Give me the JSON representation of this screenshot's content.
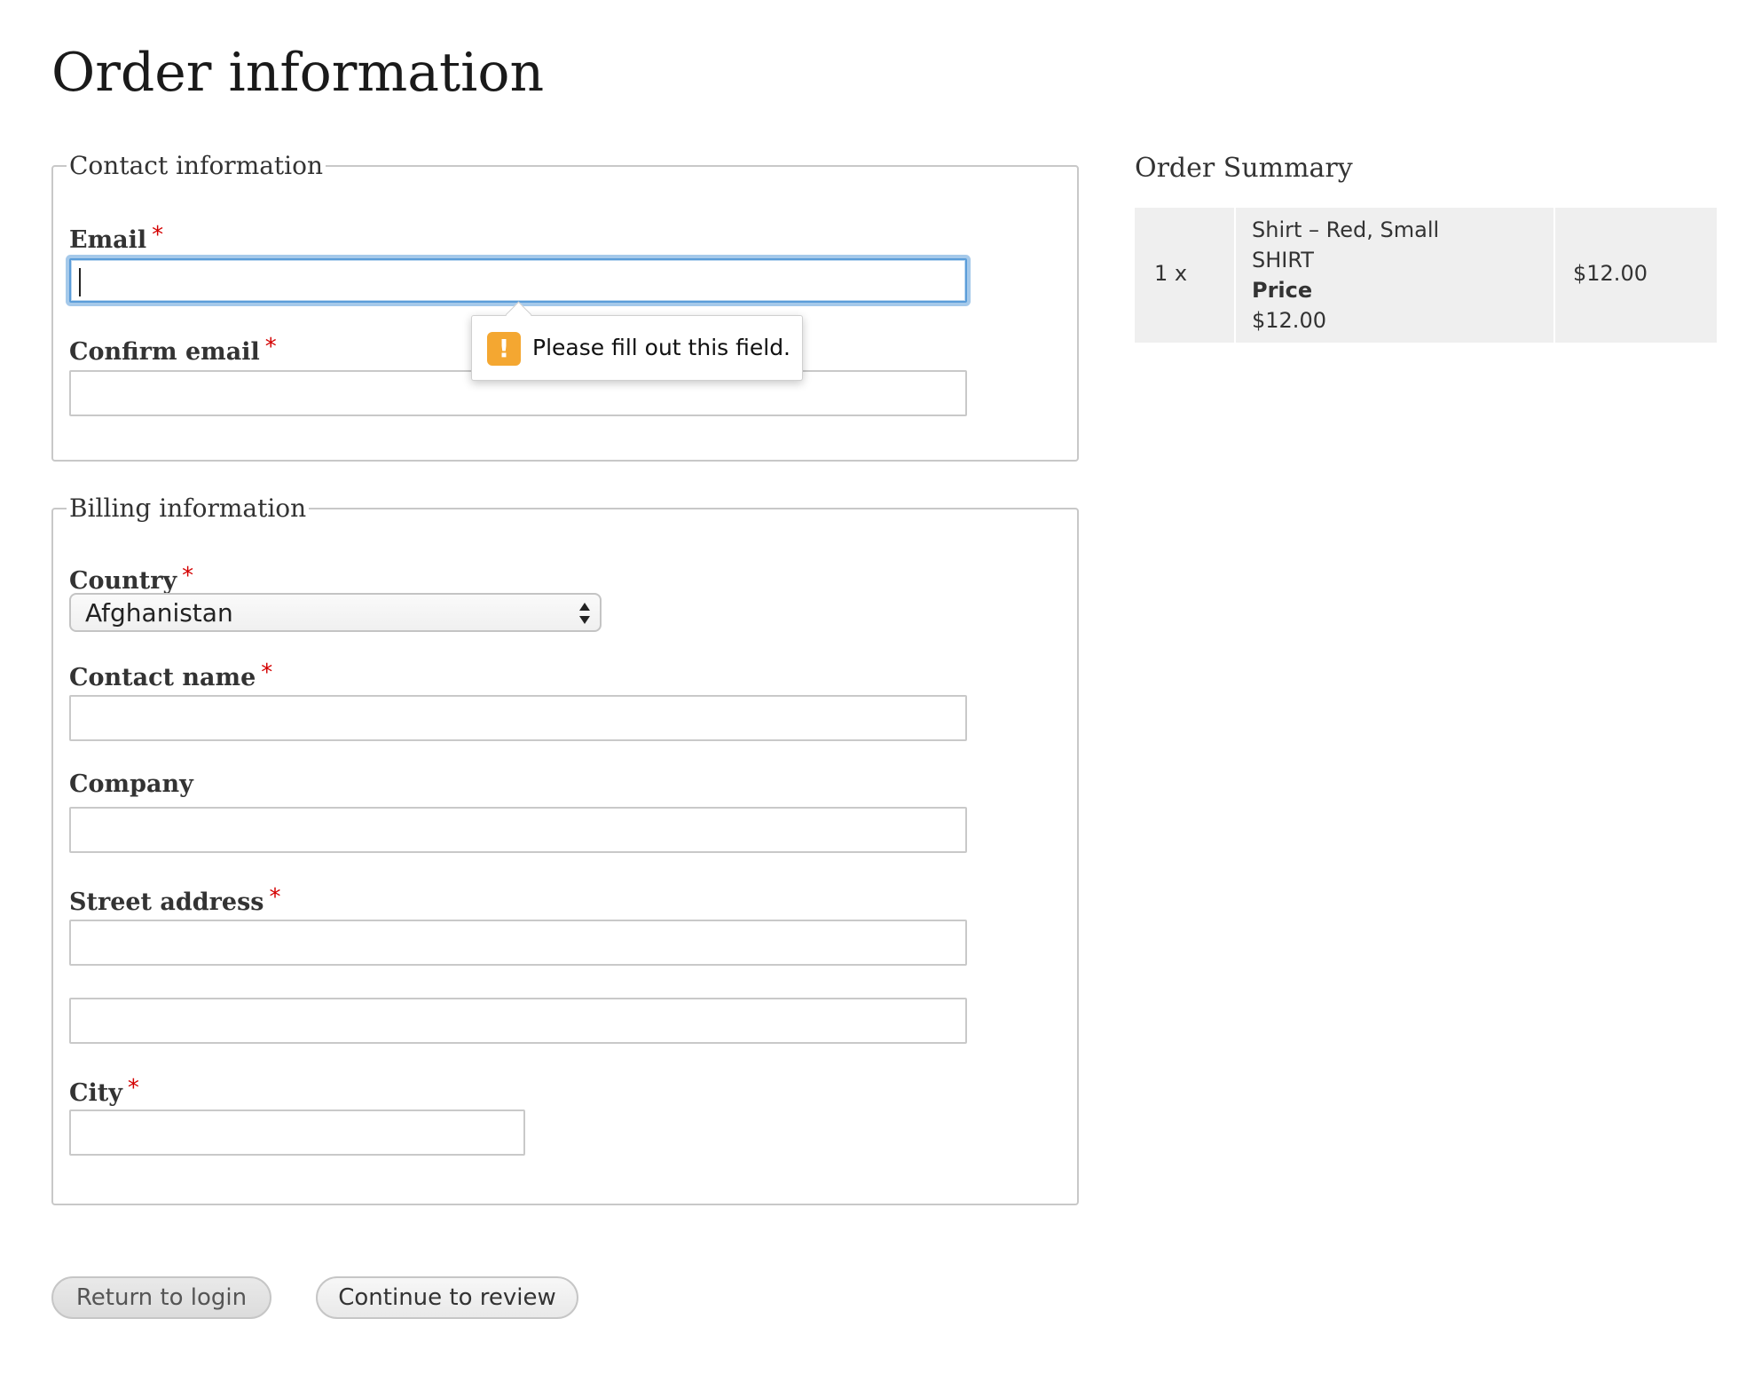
{
  "page": {
    "title": "Order information"
  },
  "contact": {
    "legend": "Contact information",
    "email_label": "Email",
    "email_value": "",
    "confirm_email_label": "Confirm email",
    "confirm_email_value": "",
    "required_marker": "*"
  },
  "validation_tooltip": {
    "icon": "warning-icon",
    "icon_glyph": "!",
    "message": "Please fill out this field.",
    "color": "#f4a731"
  },
  "billing": {
    "legend": "Billing information",
    "country_label": "Country",
    "country_value": "Afghanistan",
    "contact_name_label": "Contact name",
    "company_label": "Company",
    "street_address_label": "Street address",
    "city_label": "City",
    "required_marker": "*"
  },
  "summary": {
    "title": "Order Summary",
    "items": [
      {
        "quantity": "1 x",
        "name": "Shirt – Red, Small",
        "sku": "SHIRT",
        "price_label": "Price",
        "unit_price": "$12.00",
        "total": "$12.00"
      }
    ]
  },
  "actions": {
    "return_label": "Return to login",
    "continue_label": "Continue to review"
  },
  "colors": {
    "focus": "#5b9dd9",
    "required": "#d40000",
    "summary_bg": "#efefef"
  }
}
